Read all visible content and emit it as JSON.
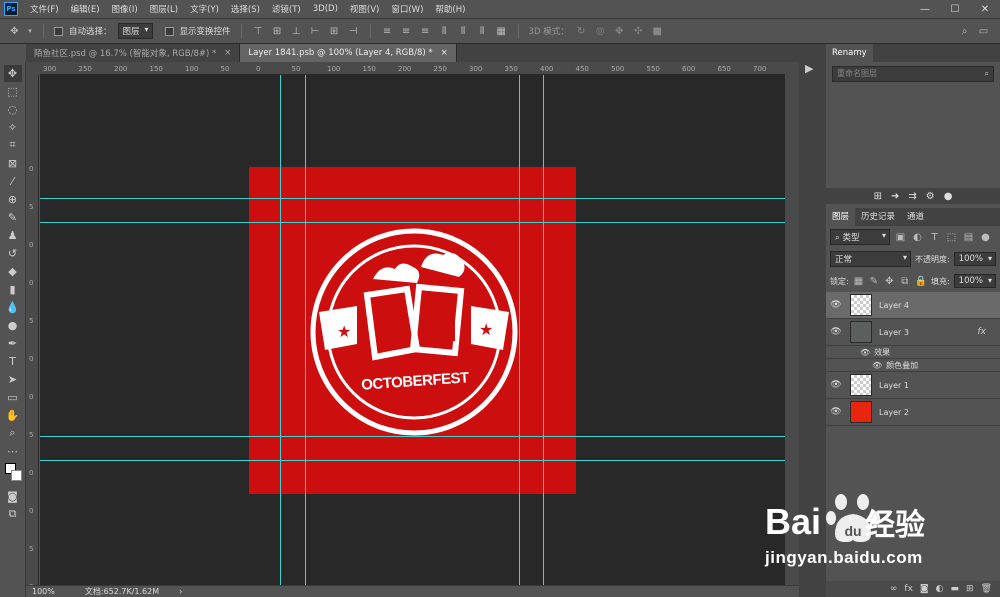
{
  "app": {
    "logo": "Ps"
  },
  "menu": [
    "文件(F)",
    "编辑(E)",
    "图像(I)",
    "图层(L)",
    "文字(Y)",
    "选择(S)",
    "滤镜(T)",
    "3D(D)",
    "视图(V)",
    "窗口(W)",
    "帮助(H)"
  ],
  "window_controls": {
    "minimize": "—",
    "maximize": "☐",
    "close": "✕"
  },
  "options": {
    "auto_select_label": "自动选择：",
    "auto_select_value": "图层",
    "transform_controls_label": "显示变换控件",
    "mode_3d_label": "3D 模式："
  },
  "tabs": [
    {
      "label": "陌鱼社区.psd @ 16.7% (智能对象, RGB/8#) *",
      "close": "×"
    },
    {
      "label": "Layer 1841.psb @ 100% (Layer 4, RGB/8) *",
      "close": "×"
    }
  ],
  "ruler_h_ticks": [
    "300",
    "250",
    "200",
    "150",
    "100",
    "50",
    "0",
    "50",
    "100",
    "150",
    "200",
    "250",
    "300",
    "350",
    "400",
    "450",
    "500",
    "550",
    "600",
    "650",
    "700",
    "750"
  ],
  "ruler_v_ticks": [
    "0",
    "5",
    "0",
    "0",
    "5",
    "0",
    "0",
    "5",
    "0",
    "0",
    "5",
    "0"
  ],
  "artwork": {
    "text": "OCTOBERFEST",
    "bg_color": "#cc0e0f"
  },
  "status": {
    "zoom": "100%",
    "doc": "文档:652.7K/1.62M",
    "arrow": "›"
  },
  "renamy": {
    "title": "Renamy",
    "placeholder": "重命名图层"
  },
  "layers_panel": {
    "tabs": [
      "图层",
      "历史记录",
      "通道"
    ],
    "filter_type": "类型",
    "blend_mode": "正常",
    "opacity_label": "不透明度:",
    "opacity_value": "100%",
    "lock_label": "锁定:",
    "fill_label": "填充:",
    "fill_value": "100%",
    "layers": [
      {
        "name": "Layer 4",
        "selected": true,
        "thumb": "checker"
      },
      {
        "name": "Layer 3",
        "selected": false,
        "thumb": "#5b5f5d",
        "fx": "fx"
      },
      {
        "name": "Layer 1",
        "selected": false,
        "thumb": "checker"
      },
      {
        "name": "Layer 2",
        "selected": false,
        "thumb": "#e8260f"
      }
    ],
    "effects_label": "效果",
    "effect_color_overlay": "颜色叠加"
  },
  "watermark": {
    "brand_left": "Bai",
    "brand_right": "经验",
    "url": "jingyan.baidu.com"
  }
}
